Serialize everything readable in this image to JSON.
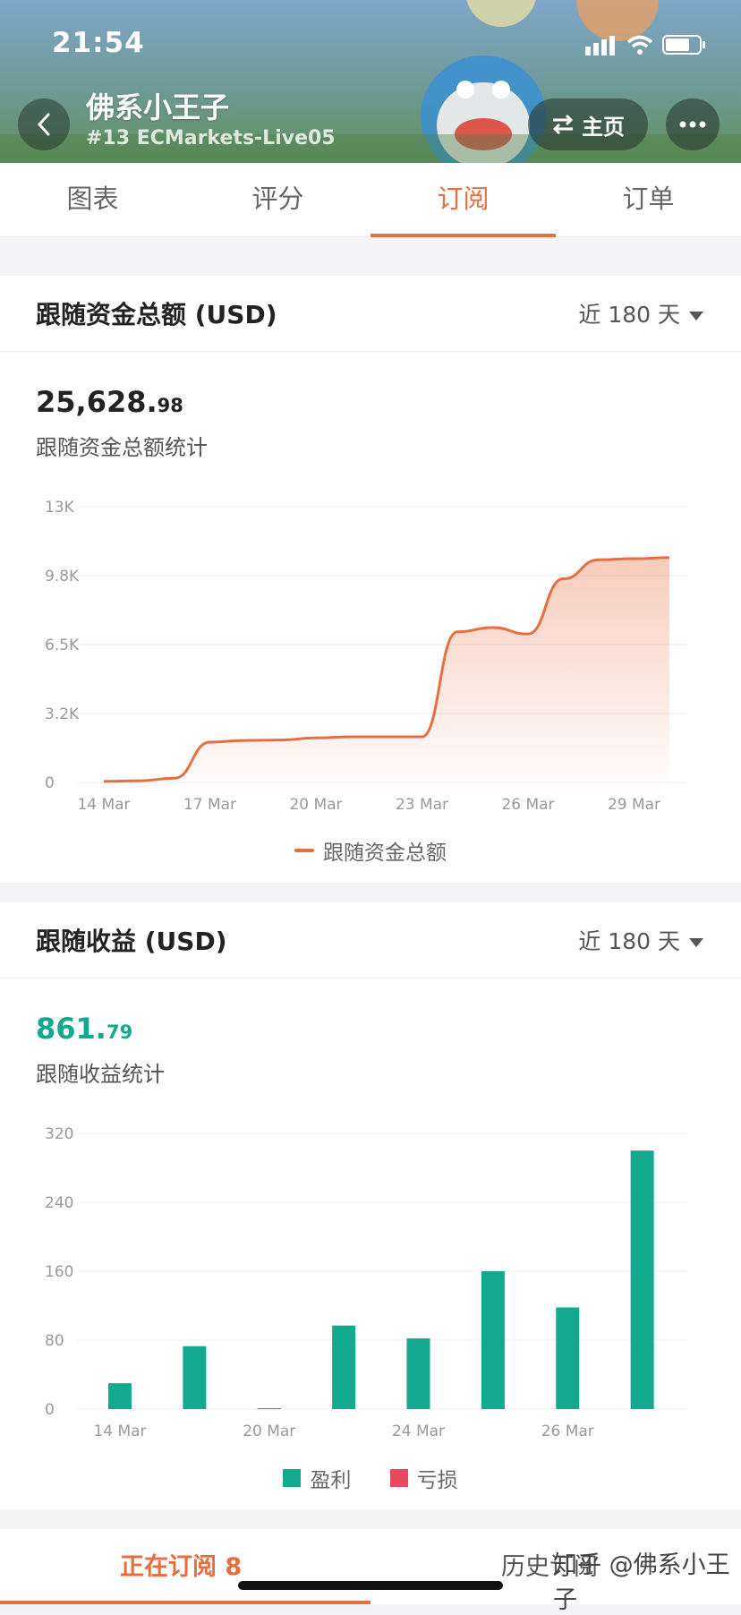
{
  "status_bar": {
    "time": "21:54"
  },
  "header": {
    "title": "佛系小王子",
    "subtitle": "#13 ECMarkets-Live05",
    "home_label": "主页"
  },
  "tabs": [
    {
      "label": "图表",
      "active": false
    },
    {
      "label": "评分",
      "active": false
    },
    {
      "label": "订阅",
      "active": true
    },
    {
      "label": "订单",
      "active": false
    }
  ],
  "funds_card": {
    "title": "跟随资金总额 (USD)",
    "range": "近 180 天",
    "value_int": "25,628.",
    "value_dec": "98",
    "stat_label": "跟随资金总额统计",
    "legend": "跟随资金总额"
  },
  "profit_card": {
    "title": "跟随收益 (USD)",
    "range": "近 180 天",
    "value_int": "861.",
    "value_dec": "79",
    "stat_label": "跟随收益统计",
    "legend_profit": "盈利",
    "legend_loss": "亏损"
  },
  "bottom": {
    "active_tab": "正在订阅 8",
    "history_tab": "历史订阅",
    "watermark": "知乎 @佛系小王子"
  },
  "colors": {
    "accent": "#e86e3f",
    "profit": "#12a98e",
    "loss": "#e8495f"
  },
  "chart_data": [
    {
      "type": "area",
      "series": [
        {
          "name": "跟随资金总额",
          "x": [
            "14 Mar",
            "15 Mar",
            "16 Mar",
            "17 Mar",
            "18 Mar",
            "19 Mar",
            "20 Mar",
            "21 Mar",
            "22 Mar",
            "23 Mar",
            "24 Mar",
            "25 Mar",
            "26 Mar",
            "27 Mar",
            "28 Mar",
            "29 Mar",
            "30 Mar"
          ],
          "values": [
            50,
            80,
            200,
            1900,
            1980,
            2000,
            2100,
            2150,
            2150,
            2150,
            7100,
            7300,
            7000,
            9600,
            10500,
            10550,
            10600
          ]
        }
      ],
      "x_ticks": [
        "14 Mar",
        "17 Mar",
        "20 Mar",
        "23 Mar",
        "26 Mar",
        "29 Mar"
      ],
      "y_ticks": [
        "0",
        "3.2K",
        "6.5K",
        "9.8K",
        "13K"
      ],
      "ylim": [
        0,
        13000
      ],
      "grid": true
    },
    {
      "type": "bar",
      "categories": [
        "14 Mar",
        "18 Mar",
        "20 Mar",
        "22 Mar",
        "24 Mar",
        "25 Mar",
        "26 Mar",
        "27 Mar"
      ],
      "series": [
        {
          "name": "盈利",
          "values": [
            30,
            73,
            1,
            97,
            82,
            160,
            118,
            300
          ]
        },
        {
          "name": "亏损",
          "values": [
            0,
            0,
            0,
            0,
            0,
            0,
            0,
            0
          ]
        }
      ],
      "x_ticks": [
        "14 Mar",
        "20 Mar",
        "24 Mar",
        "26 Mar"
      ],
      "y_ticks": [
        "0",
        "80",
        "160",
        "240",
        "320"
      ],
      "ylim": [
        0,
        320
      ],
      "grid": true
    }
  ]
}
